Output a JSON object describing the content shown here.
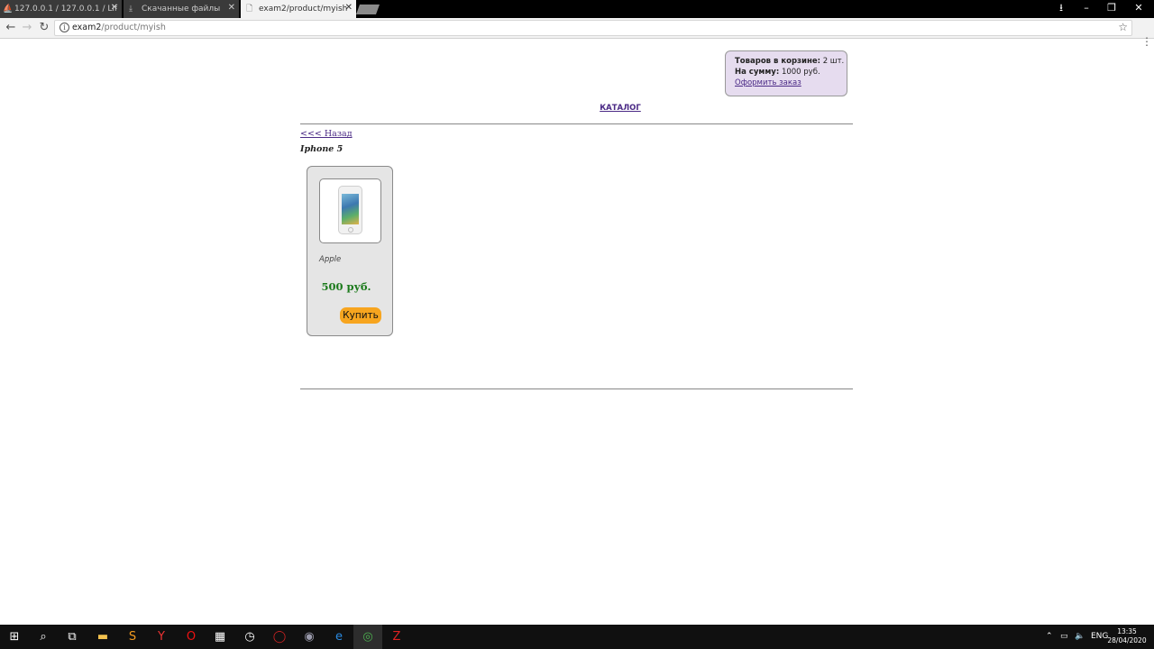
{
  "browser": {
    "tabs": [
      {
        "label": "127.0.0.1 / 127.0.0.1 / Lif",
        "icon": "pma-icon",
        "state": "inactive"
      },
      {
        "label": "Скачанные файлы",
        "icon": "download-icon",
        "state": "inactive"
      },
      {
        "label": "exam2/product/myish",
        "icon": "page-icon",
        "state": "active"
      }
    ],
    "url_host": "exam2",
    "url_path": "/product/myish"
  },
  "cart": {
    "items_label": "Товаров в корзине:",
    "items_value": "2 шт.",
    "sum_label": "На сумму:",
    "sum_value": "1000 руб.",
    "checkout_link": "Оформить заказ"
  },
  "nav": {
    "catalog_link": "КАТАЛОГ",
    "back_link": "<<< Назад"
  },
  "product": {
    "title": "Iphone 5",
    "brand": "Apple",
    "price": "500 руб.",
    "buy_label": "Купить"
  },
  "taskbar": {
    "lang": "ENG",
    "time": "13:35",
    "date": "28/04/2020"
  },
  "colors": {
    "accent_link": "#4b2a86",
    "price": "#1b7a1b",
    "buy_button": "#f7a51f",
    "cart_bg": "#e6dcef"
  }
}
